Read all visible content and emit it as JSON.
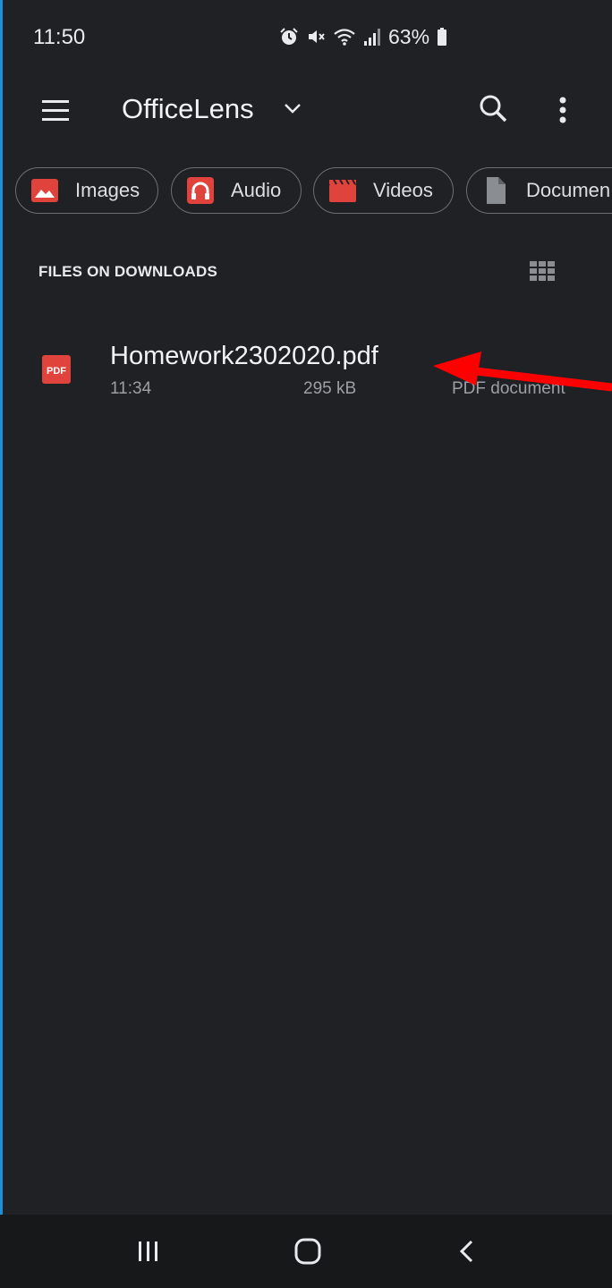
{
  "status_bar": {
    "time": "11:50",
    "battery": "63%",
    "icons": [
      "alarm-icon",
      "mute-icon",
      "wifi-icon",
      "signal-icon",
      "battery-icon"
    ]
  },
  "app_bar": {
    "title": "OfficeLens",
    "icons": [
      "menu-icon",
      "chevron-down-icon",
      "search-icon",
      "more-vert-icon"
    ]
  },
  "categories": [
    {
      "label": "Images",
      "icon": "image-icon"
    },
    {
      "label": "Audio",
      "icon": "headphones-icon"
    },
    {
      "label": "Videos",
      "icon": "video-icon"
    },
    {
      "label": "Documen",
      "icon": "document-icon"
    }
  ],
  "section": {
    "title": "FILES ON DOWNLOADS",
    "view_toggle_icon": "grid-view-icon"
  },
  "files": [
    {
      "name": "Homework2302020.pdf",
      "time": "11:34",
      "size": "295 kB",
      "type": "PDF document",
      "icon": "pdf-icon",
      "icon_text": "PDF"
    }
  ],
  "nav_bar": {
    "icons": [
      "recent-apps-icon",
      "home-icon",
      "back-icon"
    ]
  },
  "colors": {
    "background": "#202124",
    "accent_red": "#e0433b",
    "arrow_red": "#ff0000",
    "text_secondary": "#9aa0a6"
  }
}
